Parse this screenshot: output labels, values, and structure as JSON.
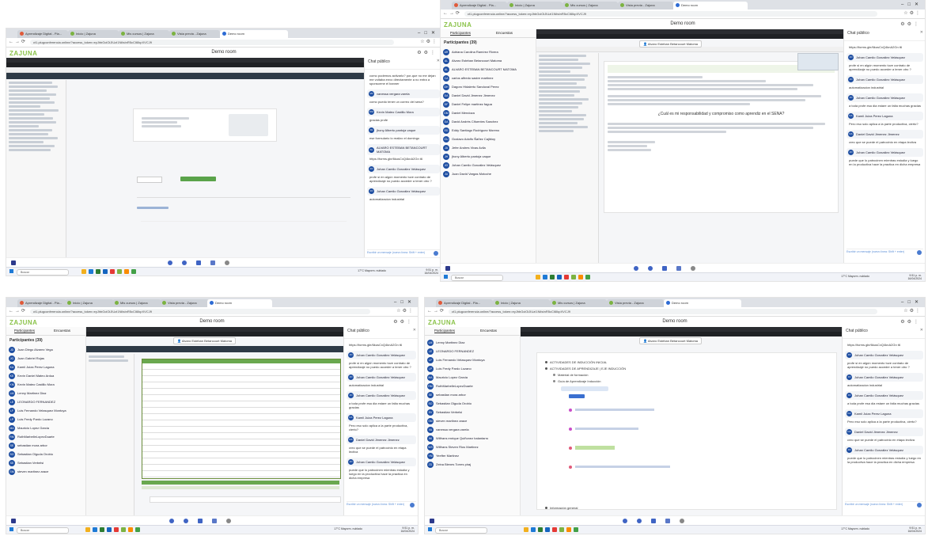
{
  "browser": {
    "tabs": [
      "Aprendizaje Digital - Pla...",
      "Inicio | Zajuna",
      "Mis cursos | Zajuna",
      "Vista previa - Zajuna",
      "Demo room"
    ],
    "url": "ct1.plugconferencia.online/?access_token=eyJhbGciOiJIUzI1NiIsInR5cCI6IkpXVCJ9"
  },
  "app": {
    "logo_main": "ZAJU",
    "logo_tail": "NA",
    "room_title": "Demo room",
    "tab_participants": "Participantes",
    "tab_surveys": "Encuestas",
    "chat_title": "Chat público",
    "chat_placeholder": "Escribir un mensaje (nuevo línea: Shift + enter)",
    "sharing_banner": "Alvaro Esteban Betancourt Matoma"
  },
  "participants_count": "Participantes (39)",
  "shots": [
    {
      "participants": [],
      "chat": [
        {
          "who": "",
          "text": "como podemos activarlo? por-que no me dejan me voltaba envo directamente a no entra a sponsorme el banner"
        },
        {
          "who": "VR",
          "name": "vanessa vergara varela",
          "text": "como puedo tener un correo del sena?"
        },
        {
          "who": "KM",
          "name": "Kevin Mateo Castillo Mora",
          "text": "gracias profe"
        },
        {
          "who": "JH",
          "name": "jhony Alberto pantoja vaque",
          "text": "ese formulario lo realizo el domingo"
        },
        {
          "who": "AL",
          "name": "ALVARO ESTEBAN BETANCOURT MATOMA",
          "text": "https://forms.gle/6kusCxQ4knA2Gn t6"
        },
        {
          "who": "JO",
          "name": "Johan Camilo González Velásquez",
          "text": "profe si en algún momento tuve contrato de aprendizaje no puedo acceder a tener otro ?"
        },
        {
          "who": "JO",
          "name": "Johan Camilo González Velásquez",
          "text": "automatizacion industrial"
        }
      ]
    },
    {
      "participants": [
        {
          "i": "AR",
          "n": "Adriana Carolina Ramírez Rivera"
        },
        {
          "i": "AL",
          "n": "Alvaro Esteban Betancourt Matoma"
        },
        {
          "i": "AL",
          "n": "ALVARO ESTEBAN BETANCOURT MATOMA"
        },
        {
          "i": "CA",
          "n": "carlos alfredo sastre martinez"
        },
        {
          "i": "DH",
          "n": "Dagoro Hidalerto Sandoval Perez"
        },
        {
          "i": "DA",
          "n": "Daniel David Jimenez Jimenez"
        },
        {
          "i": "DF",
          "n": "Daniel Felipe martinez fagua"
        },
        {
          "i": "DM",
          "n": "Daniel Mendoza"
        },
        {
          "i": "DA",
          "n": "David Andrés Cifuentes Sanchez"
        },
        {
          "i": "ED",
          "n": "Eddy Santiago Rodríguez Moreno"
        },
        {
          "i": "GU",
          "n": "Gustavo Adolfo Ñañez Cajibioy"
        },
        {
          "i": "JA",
          "n": "Jefer Andres Vivas Avila"
        },
        {
          "i": "JH",
          "n": "jhony Alberto pantoja vaque"
        },
        {
          "i": "JO",
          "n": "Johan Camilo González Velásquez"
        },
        {
          "i": "JU",
          "n": "Juan David Vargas Motoche"
        }
      ],
      "chat": [
        {
          "who": "",
          "text": "https://forms.gle/6kusCxQ4knA2Gn t6"
        },
        {
          "who": "JO",
          "name": "Johan Camilo González Velásquez",
          "text": "profe si en algún momento tuve contrato de aprendizaje no puedo acceder a tener otro ?"
        },
        {
          "who": "JO",
          "name": "Johan Camilo González Velásquez",
          "text": "automatizacion industrial"
        },
        {
          "who": "JO",
          "name": "Johan Camilo González Velásquez",
          "text": "a toda profe esa dia estare un falta muchas gracias"
        },
        {
          "who": "KA",
          "name": "Kamii Juiza Perez Laguna",
          "text": "Pero eso solo aplica a la parte productiva, cierto?"
        },
        {
          "who": "DA",
          "name": "Daniel David Jimenez Jimenez",
          "text": "creo que se puede el patrocinio en etapa lectiva"
        },
        {
          "who": "JO",
          "name": "Johan Camilo González Velásquez",
          "text": "puede que lo patrocinen mientras estudia y luego en la productiva hace la practica en dicha empresa"
        }
      ],
      "doc_question": "¿Cuál es mi responsabilidad y compromiso como aprendiz en el SENA?"
    },
    {
      "participants": [
        {
          "i": "JD",
          "n": "Juan Diego Alvarez Vega"
        },
        {
          "i": "JG",
          "n": "Juan Gabriel Rojas"
        },
        {
          "i": "KA",
          "n": "Kamii Juiza Perez Laguna"
        },
        {
          "i": "KE",
          "n": "Kevin Daniel Mateo Ardua"
        },
        {
          "i": "KM",
          "n": "Kevin Mateo Castillo Mora"
        },
        {
          "i": "LM",
          "n": "Lenny Martinez Diaz"
        },
        {
          "i": "LE",
          "n": "LEONARDO FERNANDEZ"
        },
        {
          "i": "LF",
          "n": "Luis Fernando Velasquez Montoya"
        },
        {
          "i": "LP",
          "n": "Luis Fredy Pardo Lozano"
        },
        {
          "i": "MA",
          "n": "Mauricio Lopez Garcia"
        },
        {
          "i": "RM",
          "n": "RuthMarbelleLopezDuarte"
        },
        {
          "i": "SE",
          "n": "sebastian mora arbor"
        },
        {
          "i": "SO",
          "n": "Sebastian Olguda Orobio"
        },
        {
          "i": "SE",
          "n": "Sebastian Verbelsi"
        },
        {
          "i": "SM",
          "n": "steven martinez arace"
        }
      ],
      "chat": [
        {
          "who": "",
          "text": "https://forms.gle/6kusCxQ4knA2Gn t6"
        },
        {
          "who": "JO",
          "name": "Johan Camilo González Velásquez",
          "text": "profe si en algún momento tuve contrato de aprendizaje no puedo acceder a tener otro ?"
        },
        {
          "who": "JO",
          "name": "Johan Camilo González Velásquez",
          "text": "automatizacion industrial"
        },
        {
          "who": "JO",
          "name": "Johan Camilo González Velásquez",
          "text": "a toda profe esa dia estare un falta muchas gracias"
        },
        {
          "who": "KA",
          "name": "Kamii Juiza Perez Laguna",
          "text": "Pero eso solo aplica a la parte productiva, cierto?"
        },
        {
          "who": "DA",
          "name": "Daniel David Jimenez Jimenez",
          "text": "creo que se puede el patrocinio en etapa lectiva"
        },
        {
          "who": "JO",
          "name": "Johan Camilo González Velásquez",
          "text": "puede que lo patrocinen mientras estudia y luego en la productiva hace la practica en dicha empresa"
        }
      ]
    },
    {
      "participants": [
        {
          "i": "LM",
          "n": "Lenny Martinez Diaz"
        },
        {
          "i": "LE",
          "n": "LEONARDO FERNANDEZ"
        },
        {
          "i": "LF",
          "n": "Luis Fernando Velasquez Montoya"
        },
        {
          "i": "LP",
          "n": "Luis Fredy Pardo Lozano"
        },
        {
          "i": "MA",
          "n": "Mauricio Lopez Garcia"
        },
        {
          "i": "RM",
          "n": "RuthMarbelleLopezDuarte"
        },
        {
          "i": "SE",
          "n": "sebastian mora arbor"
        },
        {
          "i": "SO",
          "n": "Sebastian Olguda Orobio"
        },
        {
          "i": "SV",
          "n": "Sebastian Verbelsi"
        },
        {
          "i": "SM",
          "n": "steven martinez arace"
        },
        {
          "i": "VA",
          "n": "vanessa vergara varela"
        },
        {
          "i": "WI",
          "n": "Wilfrans enrique Quiñonez balantarro"
        },
        {
          "i": "WS",
          "n": "Wilfrans Steven Rios Martinez"
        },
        {
          "i": "YM",
          "n": "Yeefter Martinez"
        },
        {
          "i": "ZD",
          "n": "Zeina Bienes Torres piraj"
        }
      ],
      "chat": [
        {
          "who": "",
          "text": "https://forms.gle/6kusCxQ4knA2Gn t6"
        },
        {
          "who": "JO",
          "name": "Johan Camilo González Velásquez",
          "text": "profe si en algún momento tuve contrato de aprendizaje no puedo acceder a tener otro ?"
        },
        {
          "who": "JO",
          "name": "Johan Camilo González Velásquez",
          "text": "automatizacion industrial"
        },
        {
          "who": "JO",
          "name": "Johan Camilo González Velásquez",
          "text": "a toda profe esa dia estare un falta muchas gracias"
        },
        {
          "who": "KA",
          "name": "Kamii Juiza Perez Laguna",
          "text": "Pero eso solo aplica a la parte productiva, cierto?"
        },
        {
          "who": "DA",
          "name": "Daniel David Jimenez Jimenez",
          "text": "creo que se puede el patrocinio en etapa lectiva"
        },
        {
          "who": "JO",
          "name": "Johan Camilo González Velásquez",
          "text": "puede que lo patrocinen mientras estudia y luego en la productiva hace la practica en dicha empresa"
        }
      ],
      "topics": [
        "ACTIVIDADES DE INDUCCIÓN INICIAL",
        "ACTIVIDADES DE APRENDIZAJE | EJE INDUCCIÓN",
        "Material de formación",
        "Guía de Aprendizaje Inducción",
        "Información general"
      ]
    }
  ],
  "taskbar": {
    "search": "Buscar",
    "weather": "17°C Mayorm. nublado",
    "time": "9:51 p. m.",
    "date": "16/04/2024"
  }
}
